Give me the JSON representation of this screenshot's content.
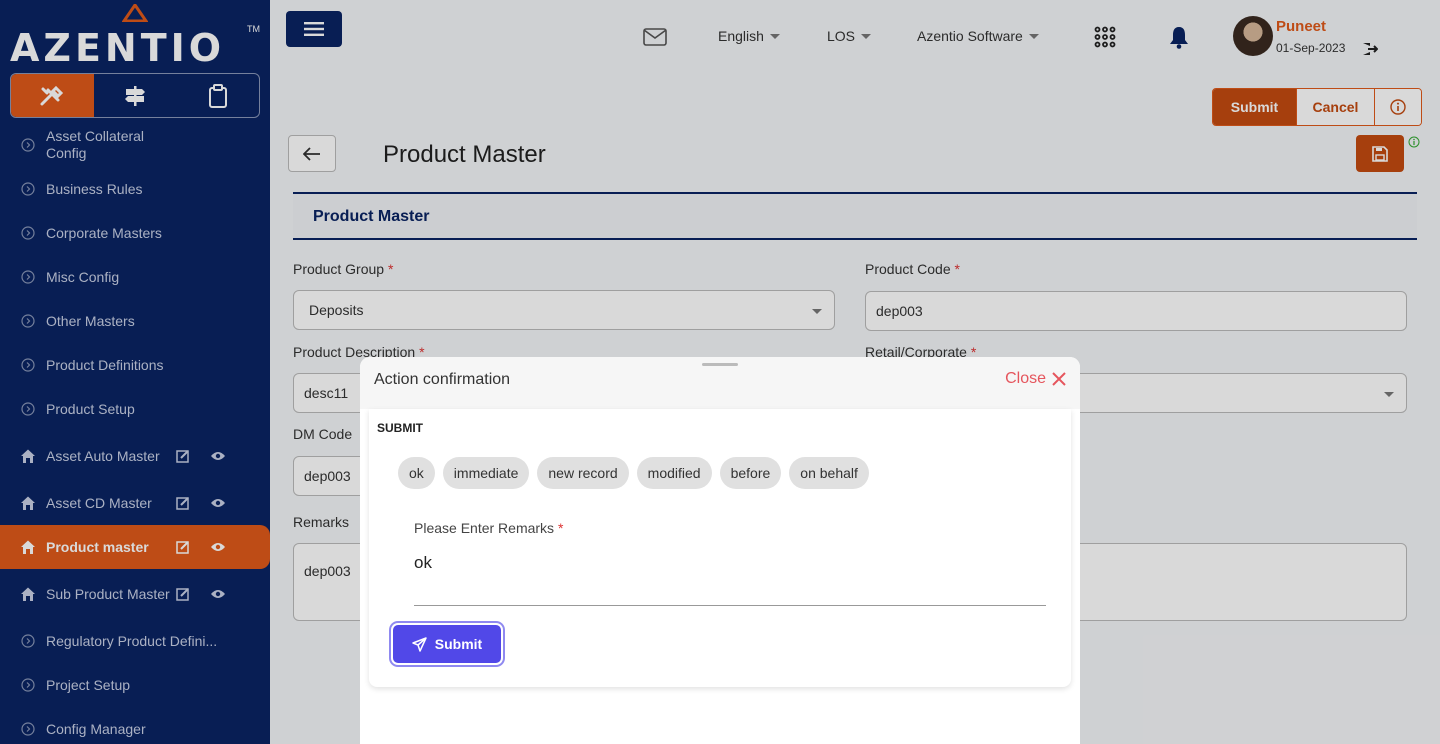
{
  "brand": {
    "name": "AZENTIO",
    "tm": "TM"
  },
  "sidebar": {
    "items": [
      {
        "label": "Asset Collateral Config"
      },
      {
        "label": "Business Rules"
      },
      {
        "label": "Corporate Masters"
      },
      {
        "label": "Misc Config"
      },
      {
        "label": "Other Masters"
      },
      {
        "label": "Product Definitions"
      },
      {
        "label": "Product Setup"
      },
      {
        "label": "Asset Auto Master"
      },
      {
        "label": "Asset CD Master"
      },
      {
        "label": "Product master"
      },
      {
        "label": "Sub Product Master"
      },
      {
        "label": "Regulatory Product Defini..."
      },
      {
        "label": "Project Setup"
      },
      {
        "label": "Config Manager"
      }
    ]
  },
  "topbar": {
    "language": "English",
    "module": "LOS",
    "company": "Azentio Software",
    "user_name": "Puneet",
    "date": "01-Sep-2023"
  },
  "actions": {
    "submit": "Submit",
    "cancel": "Cancel"
  },
  "page": {
    "title": "Product Master",
    "section": "Product Master",
    "fields": {
      "product_group": {
        "label": "Product Group",
        "value": "Deposits"
      },
      "product_code": {
        "label": "Product Code",
        "value": "dep003"
      },
      "product_description": {
        "label": "Product Description",
        "value": "desc11"
      },
      "retail_corporate": {
        "label": "Retail/Corporate",
        "value": ""
      },
      "dm_code": {
        "label": "DM Code",
        "value": "dep003"
      },
      "remarks": {
        "label": "Remarks",
        "value": "dep003"
      }
    }
  },
  "modal": {
    "title": "Action confirmation",
    "close": "Close",
    "subtitle": "SUBMIT",
    "chips": [
      "ok",
      "immediate",
      "new record",
      "modified",
      "before",
      "on behalf"
    ],
    "remarks_label": "Please Enter Remarks",
    "remarks_value": "ok",
    "submit": "Submit"
  },
  "colors": {
    "navy": "#0a2463",
    "orange": "#e05a1a",
    "purple": "#5148e8"
  }
}
